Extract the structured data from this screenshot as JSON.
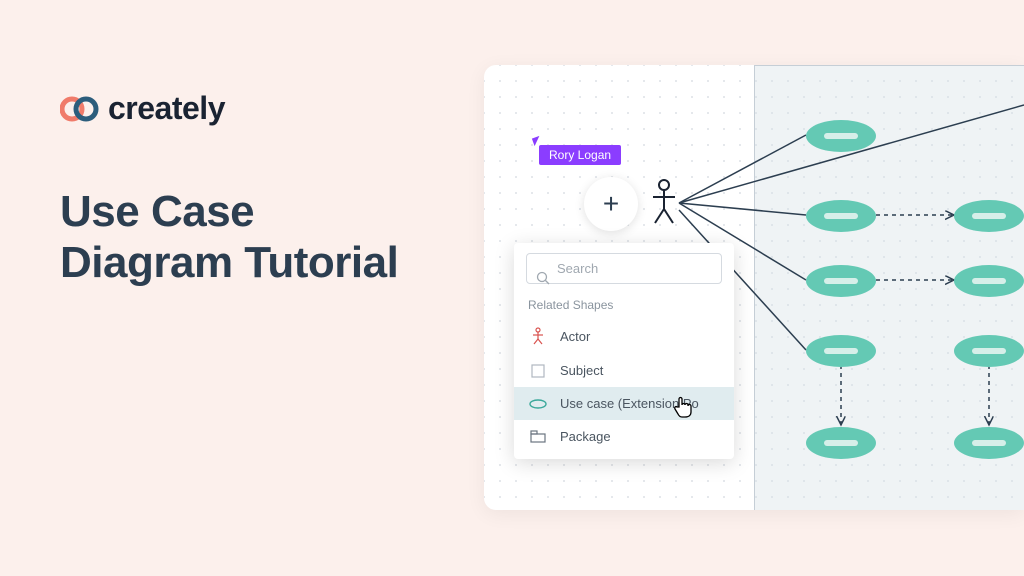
{
  "brand": "creately",
  "headline_line1": "Use Case",
  "headline_line2": "Diagram Tutorial",
  "user_tag": "Rory Logan",
  "search_placeholder": "Search",
  "related_shapes_label": "Related Shapes",
  "shapes": {
    "actor": "Actor",
    "subject": "Subject",
    "usecase_ext": "Use case (Extension Po",
    "package": "Package"
  }
}
